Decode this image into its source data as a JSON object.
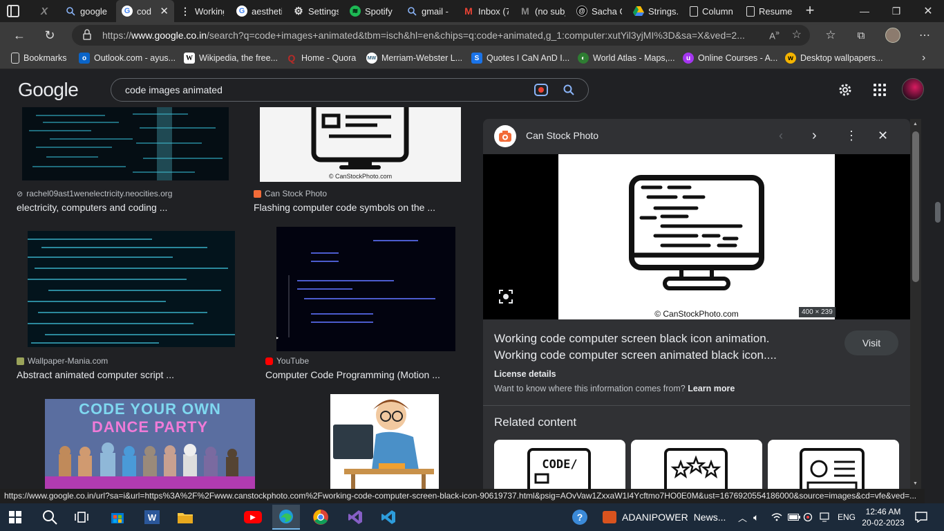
{
  "tabs": [
    {
      "title": "",
      "icon": "x-icon"
    },
    {
      "title": "google",
      "icon": "search-icon"
    },
    {
      "title": "cod",
      "icon": "google-icon",
      "active": true
    },
    {
      "title": "Working",
      "icon": "menu-dots-icon"
    },
    {
      "title": "aestheti",
      "icon": "google-icon"
    },
    {
      "title": "Settings",
      "icon": "gear-icon"
    },
    {
      "title": "Spotify -",
      "icon": "spotify-icon"
    },
    {
      "title": "gmail - S",
      "icon": "search-icon"
    },
    {
      "title": "Inbox (7",
      "icon": "gmail-icon"
    },
    {
      "title": "(no subj",
      "icon": "gmail-icon"
    },
    {
      "title": "Sacha G",
      "icon": "threads-icon"
    },
    {
      "title": "Strings.p",
      "icon": "drive-icon"
    },
    {
      "title": "Column",
      "icon": "document-icon"
    },
    {
      "title": "Resume",
      "icon": "document-icon"
    }
  ],
  "address": {
    "url_prefix": "https://",
    "url_domain": "www.google.co.in",
    "url_rest": "/search?q=code+images+animated&tbm=isch&hl=en&chips=q:code+animated,g_1:computer:xutYil3yjMI%3D&sa=X&ved=2..."
  },
  "bookmarks": [
    {
      "label": "Bookmarks",
      "icon": "document-icon"
    },
    {
      "label": "Outlook.com - ayus...",
      "icon": "outlook-icon"
    },
    {
      "label": "Wikipedia, the free...",
      "icon": "wikipedia-icon"
    },
    {
      "label": "Home - Quora",
      "icon": "quora-icon"
    },
    {
      "label": "Merriam-Webster L...",
      "icon": "mw-icon"
    },
    {
      "label": "Quotes I CaN AnD I...",
      "icon": "s-icon"
    },
    {
      "label": "World Atlas - Maps,...",
      "icon": "globe-icon"
    },
    {
      "label": "Online Courses - A...",
      "icon": "udemy-icon"
    },
    {
      "label": "Desktop wallpapers...",
      "icon": "wallpaper-icon"
    }
  ],
  "google": {
    "logo": "Google",
    "query": "code images animated"
  },
  "results": [
    {
      "source": "rachel09ast1wenelectricity.neocities.org",
      "title": "electricity, computers and coding ..."
    },
    {
      "source": "Can Stock Photo",
      "title": "Flashing computer code symbols on the ..."
    },
    {
      "source": "Wallpaper-Mania.com",
      "title": "Abstract animated computer script ..."
    },
    {
      "source": "YouTube",
      "title": "Computer Code Programming (Motion ..."
    }
  ],
  "thumb_texts": {
    "canstock_caption": "© CanStockPhoto.com",
    "dance_line1": "CODE YOUR OWN",
    "dance_line2": "DANCE PARTY"
  },
  "panel": {
    "source": "Can Stock Photo",
    "image_caption": "© CanStockPhoto.com",
    "dimensions": "400 × 239",
    "title_line1": "Working code computer screen black icon animation.",
    "title_line2": "Working code computer screen animated black icon....",
    "visit_label": "Visit",
    "license_label": "License details",
    "info_text": "Want to know where this information comes from?",
    "learn_more": "Learn more",
    "related_heading": "Related content",
    "related_card_text": "CODE/"
  },
  "status_url": "https://www.google.co.in/url?sa=i&url=https%3A%2F%2Fwww.canstockphoto.com%2Fworking-code-computer-screen-black-icon-90619737.html&psig=AOvVaw1ZxxaW1I4Ycftmo7HO0E0M&ust=1676920554186000&source=images&cd=vfe&ved=...",
  "taskbar": {
    "news": "ADANIPOWER",
    "news2": "News...",
    "lang": "ENG",
    "time": "12:46 AM",
    "date": "20-02-2023"
  },
  "colors": {
    "accent": "#8ab4f8",
    "visit_bg": "#3c4043",
    "taskbar": "#1c2a3a"
  }
}
